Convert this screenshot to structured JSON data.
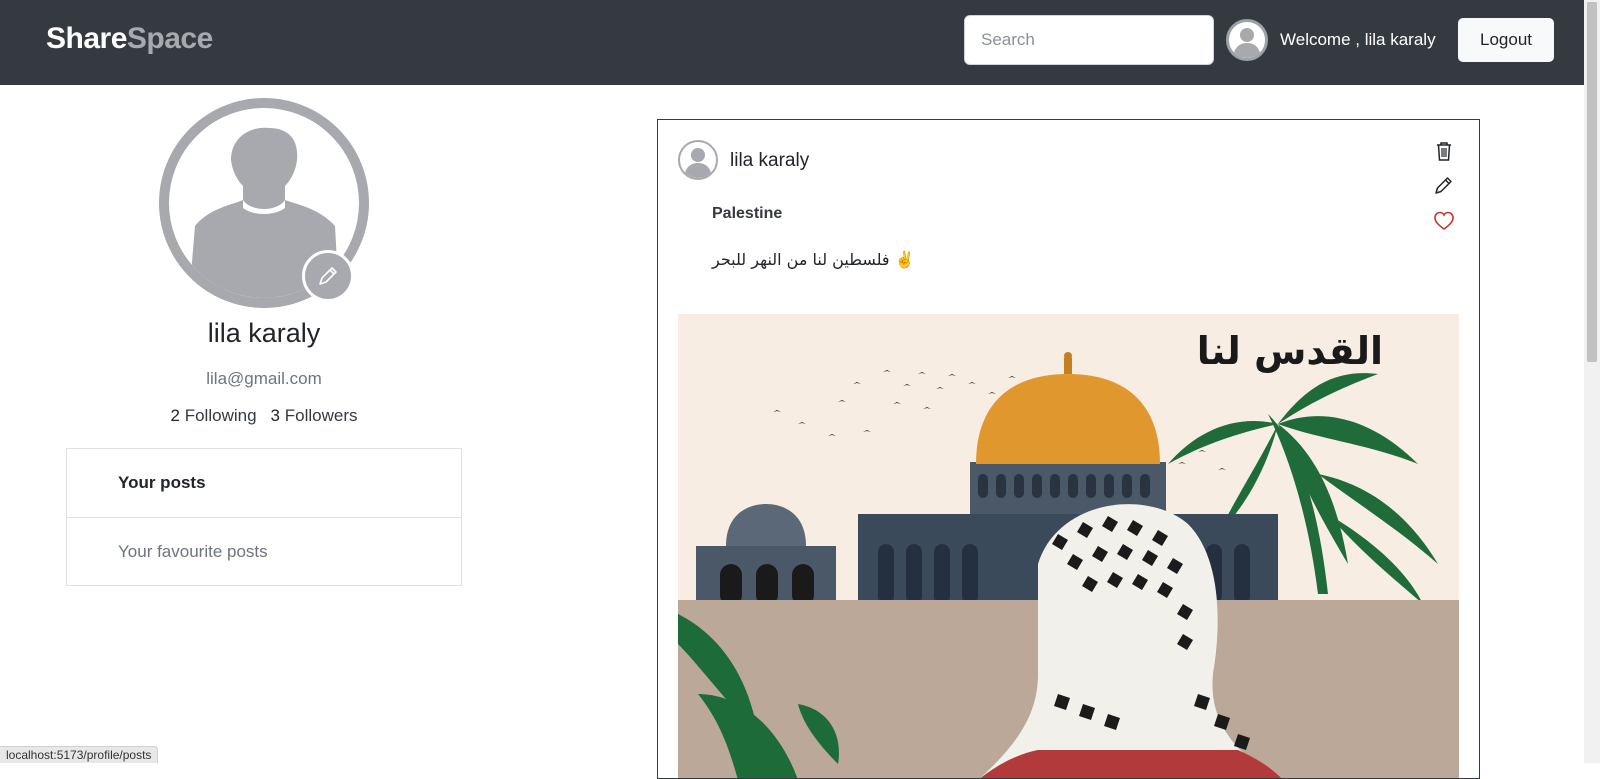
{
  "navbar": {
    "brand_part1": "Share",
    "brand_part2": "Space",
    "search_placeholder": "Search",
    "welcome_text": "Welcome , lila karaly",
    "logout_label": "Logout"
  },
  "profile": {
    "name": "lila karaly",
    "email": "lila@gmail.com",
    "following_count": "2",
    "following_label": "Following",
    "followers_count": "3",
    "followers_label": "Followers",
    "menu": [
      {
        "label": "Your posts"
      },
      {
        "label": "Your favourite posts"
      }
    ]
  },
  "post": {
    "author": "lila karaly",
    "title": "Palestine",
    "body": "فلسطين لنا من النهر للبحر ✌️",
    "image_caption": "القدس لنا",
    "icons": [
      "trash-icon",
      "pencil-icon",
      "heart-icon"
    ],
    "heart_color": "#c0392b"
  },
  "status_bar": {
    "url": "localhost:5173/profile/posts"
  },
  "colors": {
    "navbar_bg": "#343a40",
    "brand_accent": "#a7a9ae",
    "avatar_gray": "#a7a9ae"
  }
}
